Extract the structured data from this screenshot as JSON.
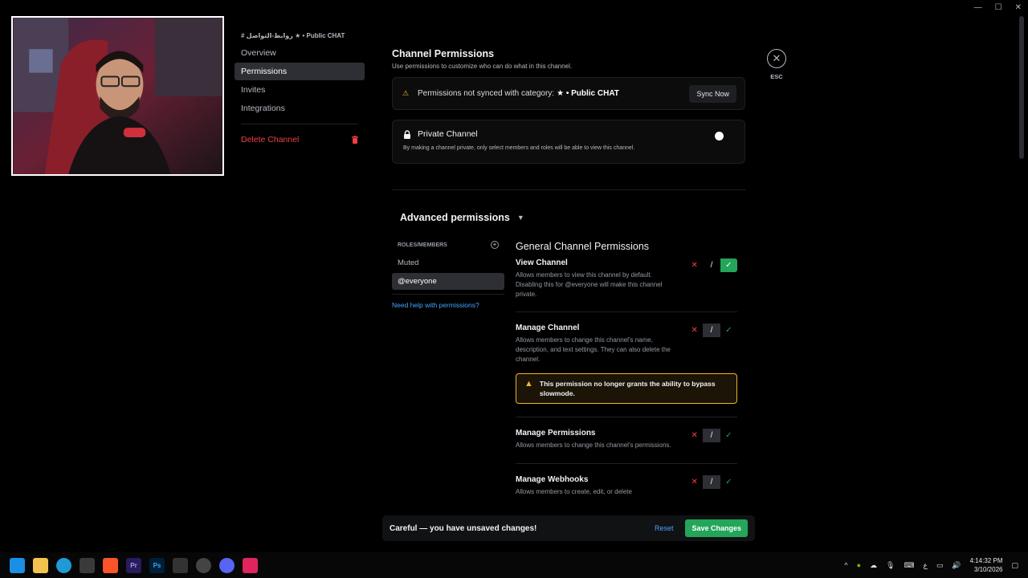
{
  "sidebar": {
    "header": "# روابط-التواصل ★ • Public CHAT",
    "items": [
      {
        "label": "Overview"
      },
      {
        "label": "Permissions"
      },
      {
        "label": "Invites"
      },
      {
        "label": "Integrations"
      }
    ],
    "delete_label": "Delete Channel"
  },
  "close": {
    "esc_label": "ESC"
  },
  "main": {
    "title": "Channel Permissions",
    "subtitle": "Use permissions to customize who can do what in this channel.",
    "sync": {
      "message": "Permissions not synced with category:",
      "category": "★ • Public CHAT",
      "button": "Sync Now"
    },
    "private": {
      "label": "Private Channel",
      "description": "By making a channel private, only select members and roles will be able to view this channel.",
      "enabled": false
    },
    "advanced_label": "Advanced permissions"
  },
  "roles": {
    "header": "ROLES/MEMBERS",
    "items": [
      "Muted",
      "@everyone"
    ],
    "selected": "@everyone",
    "help_link": "Need help with permissions?"
  },
  "permissions": {
    "title": "General Channel Permissions",
    "items": [
      {
        "name": "View Channel",
        "description": "Allows members to view this channel by default. Disabling this for @everyone will make this channel private.",
        "state": "allow"
      },
      {
        "name": "Manage Channel",
        "description": "Allows members to change this channel's name, description, and text settings. They can also delete the channel.",
        "state": "neutral",
        "warning": "This permission no longer grants the ability to bypass slowmode."
      },
      {
        "name": "Manage Permissions",
        "description": "Allows members to change this channel's permissions.",
        "state": "neutral"
      },
      {
        "name": "Manage Webhooks",
        "description": "Allows members to create, edit, or delete",
        "state": "neutral"
      }
    ]
  },
  "savebar": {
    "message": "Careful — you have unsaved changes!",
    "reset": "Reset",
    "save": "Save Changes"
  },
  "taskbar": {
    "apps": [
      "windows-start",
      "file-explorer",
      "edge",
      "store",
      "brave",
      "premiere-pro",
      "photoshop",
      "obs",
      "chrome",
      "discord",
      "tiktok"
    ],
    "tray_lang": "ع",
    "time": "4:14:32 PM",
    "date": "3/10/2026"
  },
  "colors": {
    "accent_green": "#23a55a",
    "danger": "#f23f43",
    "link": "#4aa1ff",
    "warning": "#f0b232"
  }
}
